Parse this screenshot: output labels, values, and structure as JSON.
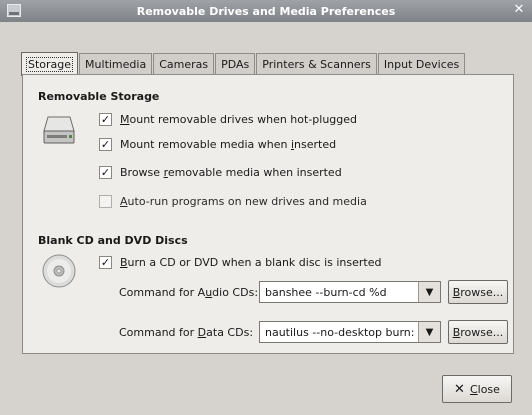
{
  "window": {
    "title": "Removable Drives and Media Preferences"
  },
  "tabs": [
    {
      "label": "Storage",
      "active": true
    },
    {
      "label": "Multimedia",
      "active": false
    },
    {
      "label": "Cameras",
      "active": false
    },
    {
      "label": "PDAs",
      "active": false
    },
    {
      "label": "Printers & Scanners",
      "active": false
    },
    {
      "label": "Input Devices",
      "active": false
    }
  ],
  "removable_storage": {
    "title": "Removable Storage",
    "icon": "drive-icon",
    "options": [
      {
        "pre": "",
        "mnemonic": "M",
        "post": "ount removable drives when hot-plugged",
        "checked": true
      },
      {
        "pre": "Mount removable media when ",
        "mnemonic": "i",
        "post": "nserted",
        "checked": true
      },
      {
        "pre": "Browse ",
        "mnemonic": "r",
        "post": "emovable media when inserted",
        "checked": true
      },
      {
        "pre": "",
        "mnemonic": "A",
        "post": "uto-run programs on new drives and media",
        "checked": false
      }
    ]
  },
  "blank_discs": {
    "title": "Blank CD and DVD Discs",
    "icon": "disc-icon",
    "option": {
      "pre": "",
      "mnemonic": "B",
      "post": "urn a CD or DVD when a blank disc is inserted",
      "checked": true
    },
    "audio": {
      "pre": "Command for A",
      "mnemonic": "u",
      "post": "dio CDs:",
      "value": "banshee --burn-cd %d"
    },
    "data": {
      "pre": "Command for ",
      "mnemonic": "D",
      "post": "ata CDs:",
      "value": "nautilus --no-desktop burn:"
    },
    "browse": {
      "mnemonic": "B",
      "post": "rowse..."
    }
  },
  "footer": {
    "close": {
      "mnemonic": "C",
      "post": "lose"
    }
  },
  "colors": {
    "titlebar": "#8a8e93",
    "panel": "#efede9",
    "window": "#d6d3ce"
  }
}
